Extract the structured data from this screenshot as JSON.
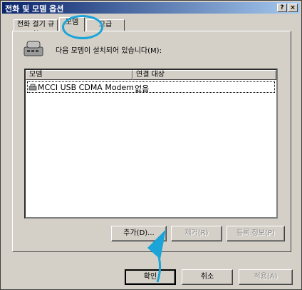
{
  "window": {
    "title": "전화 및 모뎀 옵션"
  },
  "tabs": [
    {
      "label": "전화 걸기 규칙"
    },
    {
      "label": "모뎀"
    },
    {
      "label": "고급"
    }
  ],
  "modems_tab": {
    "intro": "다음 모뎀이 설치되어 있습니다(M):",
    "columns": {
      "modem": "모뎀",
      "attached_to": "연결 대상"
    },
    "rows": [
      {
        "modem": "MCCI USB CDMA Modem",
        "attached_to": "없음"
      }
    ],
    "buttons": {
      "add": "추가(D)...",
      "remove": "제거(R)",
      "properties": "등록 정보(P)"
    }
  },
  "footer": {
    "ok": "확인",
    "cancel": "취소",
    "apply": "적용(A)"
  },
  "colors": {
    "annotation": "#1aa4d8",
    "titlebar_start": "#0a246a",
    "titlebar_end": "#a6caf0"
  }
}
